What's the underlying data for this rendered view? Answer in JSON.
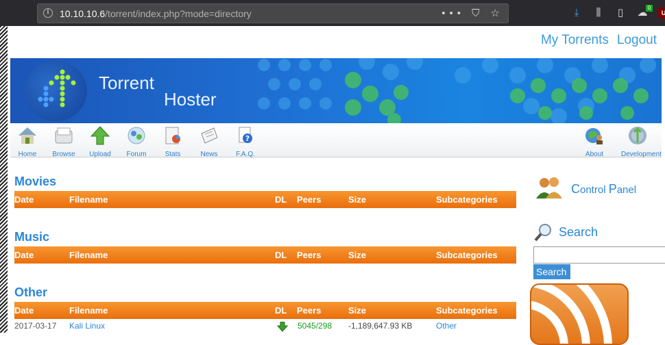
{
  "browser": {
    "url_host": "10.10.10.6",
    "url_path": "/torrent/index.php?mode=directory",
    "url_actions": "••• ⛉ ☆",
    "addon_badge": "0",
    "ub_label": "U"
  },
  "top_links": {
    "my_torrents": "My Torrents",
    "logout": "Logout"
  },
  "banner": {
    "brand_line1": "Torrent",
    "brand_line2": "Hoster"
  },
  "nav": {
    "items": [
      {
        "label": "Home",
        "icon": "home-icon"
      },
      {
        "label": "Browse",
        "icon": "browse-icon"
      },
      {
        "label": "Upload",
        "icon": "upload-icon"
      },
      {
        "label": "Forum",
        "icon": "forum-icon"
      },
      {
        "label": "Stats",
        "icon": "stats-icon"
      },
      {
        "label": "News",
        "icon": "news-icon"
      },
      {
        "label": "F.A.Q.",
        "icon": "faq-icon"
      },
      {
        "label": "About",
        "icon": "about-icon"
      },
      {
        "label": "Development",
        "icon": "development-icon"
      }
    ]
  },
  "table_headers": {
    "date": "Date",
    "filename": "Filename",
    "dl": "DL",
    "peers": "Peers",
    "size": "Size",
    "subcategories": "Subcategories"
  },
  "sections": [
    {
      "title": "Movies"
    },
    {
      "title": "Music"
    },
    {
      "title": "Other"
    }
  ],
  "rows": [
    {
      "date": "2017-03-17",
      "filename": "Kali Linux",
      "peers": "5045/298",
      "size": "-1,189,647.93 KB",
      "subcategory": "Other"
    }
  ],
  "sidebar": {
    "cp_first": "C",
    "cp_rest1": "ontrol ",
    "cp_second": "P",
    "cp_rest2": "anel",
    "search_title": "Search",
    "search_button": "Search",
    "search_value": ""
  },
  "colors": {
    "accent_blue": "#2a86d6",
    "header_orange": "#ee7a16",
    "peers_green": "#1a9a1a"
  }
}
